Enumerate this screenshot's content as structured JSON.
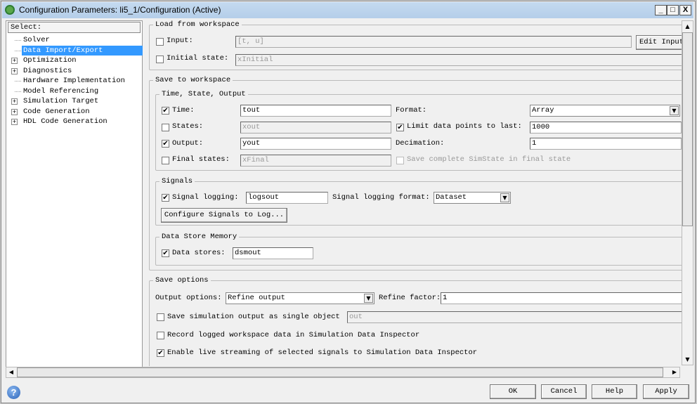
{
  "window": {
    "title": "Configuration Parameters: li5_1/Configuration (Active)",
    "minimize": "_",
    "maximize": "□",
    "close": "X"
  },
  "tree": {
    "header": "Select:",
    "items": [
      {
        "label": "Solver",
        "expandable": false
      },
      {
        "label": "Data Import/Export",
        "expandable": false,
        "selected": true
      },
      {
        "label": "Optimization",
        "expandable": true
      },
      {
        "label": "Diagnostics",
        "expandable": true
      },
      {
        "label": "Hardware Implementation",
        "expandable": false
      },
      {
        "label": "Model Referencing",
        "expandable": false
      },
      {
        "label": "Simulation Target",
        "expandable": true
      },
      {
        "label": "Code Generation",
        "expandable": true
      },
      {
        "label": "HDL Code Generation",
        "expandable": true
      }
    ]
  },
  "load": {
    "title": "Load from workspace",
    "input_label": "Input:",
    "input_value": "[t, u]",
    "input_checked": false,
    "edit_input": "Edit Input",
    "initial_label": "Initial state:",
    "initial_value": "xInitial",
    "initial_checked": false
  },
  "save": {
    "title": "Save to workspace",
    "tso": {
      "title": "Time, State, Output",
      "time_label": "Time:",
      "time_value": "tout",
      "time_checked": true,
      "states_label": "States:",
      "states_value": "xout",
      "states_checked": false,
      "output_label": "Output:",
      "output_value": "yout",
      "output_checked": true,
      "final_label": "Final states:",
      "final_value": "xFinal",
      "final_checked": false,
      "format_label": "Format:",
      "format_value": "Array",
      "limit_label": "Limit data points to last:",
      "limit_value": "1000",
      "limit_checked": true,
      "decimation_label": "Decimation:",
      "decimation_value": "1",
      "simstate_label": "Save complete SimState in final state",
      "simstate_checked": false
    },
    "signals": {
      "title": "Signals",
      "logging_label": "Signal logging:",
      "logging_value": "logsout",
      "logging_checked": true,
      "format_label": "Signal logging format:",
      "format_value": "Dataset",
      "configure_button": "Configure Signals to Log..."
    },
    "dsm": {
      "title": "Data Store Memory",
      "label": "Data stores:",
      "value": "dsmout",
      "checked": true
    }
  },
  "options": {
    "title": "Save options",
    "output_options_label": "Output options:",
    "output_options_value": "Refine output",
    "refine_label": "Refine factor:",
    "refine_value": "1",
    "single_label": "Save simulation output as single object",
    "single_value": "out",
    "single_checked": false,
    "record_label": "Record logged workspace data in Simulation Data Inspector",
    "record_checked": false,
    "stream_label": "Enable live streaming of selected signals to Simulation Data Inspector",
    "stream_checked": true
  },
  "buttons": {
    "ok": "OK",
    "cancel": "Cancel",
    "help": "Help",
    "apply": "Apply"
  }
}
